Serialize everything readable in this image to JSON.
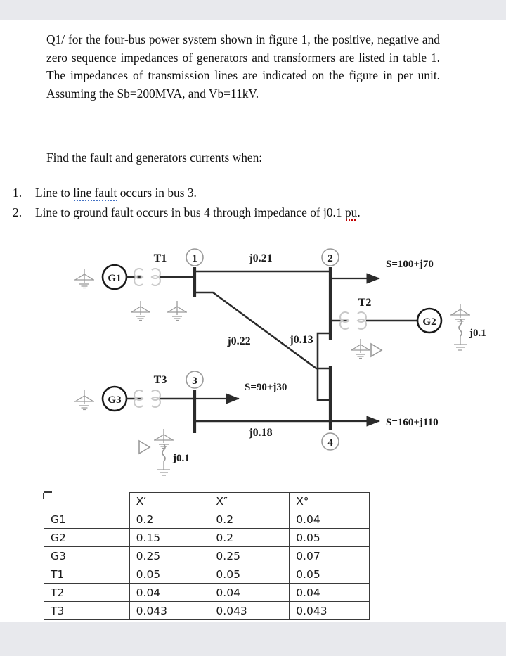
{
  "document": {
    "question_id": "Q1/",
    "paragraph_1": "Q1/ for the four-bus power system shown in figure 1, the positive, negative and zero sequence impedances of generators and transformers are listed in table 1. The impedances of transmission lines are indicated on the figure in per unit. Assuming the Sb=200MVA, and Vb=11kV.",
    "paragraph_2": "Find the fault and generators currents when:",
    "list": [
      {
        "number": "1.",
        "text_before": "Line to ",
        "misspelled": "line  fault",
        "text_after": " occurs in bus 3."
      },
      {
        "number": "2.",
        "text_before": "Line to ground fault occurs in bus 4 through impedance of j0.1 ",
        "misspelled": "pu",
        "text_after": "."
      }
    ],
    "base_values": {
      "Sb": "200MVA",
      "Vb": "11kV"
    }
  },
  "diagram": {
    "title": "figure 1",
    "buses": [
      {
        "id": "1",
        "label": "1"
      },
      {
        "id": "2",
        "label": "2"
      },
      {
        "id": "3",
        "label": "3"
      },
      {
        "id": "4",
        "label": "4"
      }
    ],
    "generators": [
      {
        "id": "G1",
        "label": "G1"
      },
      {
        "id": "G2",
        "label": "G2"
      },
      {
        "id": "G3",
        "label": "G3"
      }
    ],
    "transformers": [
      {
        "id": "T1",
        "label": "T1"
      },
      {
        "id": "T2",
        "label": "T2"
      },
      {
        "id": "T3",
        "label": "T3"
      }
    ],
    "lines": [
      {
        "from": "1",
        "to": "2",
        "label": "j0.21"
      },
      {
        "from": "1",
        "to": "4",
        "label": "j0.22"
      },
      {
        "from": "2",
        "to": "4",
        "label": "j0.13"
      },
      {
        "from": "3",
        "to": "4",
        "label": "j0.18"
      }
    ],
    "loads": [
      {
        "bus": "2",
        "label": "S=100+j70"
      },
      {
        "bus": "3",
        "label": "S=90+j30"
      },
      {
        "bus": "4",
        "label": "S=160+j110"
      }
    ],
    "grounding_impedances": [
      {
        "near": "G2",
        "label": "j0.1"
      },
      {
        "near": "T3",
        "label": "j0.1"
      }
    ]
  },
  "table": {
    "caption": "table 1",
    "headers": [
      "",
      "X′",
      "X″",
      "X°"
    ],
    "header_plain": [
      "",
      "X'",
      "X\"",
      "X0"
    ],
    "rows": [
      {
        "name": "G1",
        "x_prime": "0.2",
        "x_dprime": "0.2",
        "x_zero": "0.04"
      },
      {
        "name": "G2",
        "x_prime": "0.15",
        "x_dprime": "0.2",
        "x_zero": "0.05"
      },
      {
        "name": "G3",
        "x_prime": "0.25",
        "x_dprime": "0.25",
        "x_zero": "0.07"
      },
      {
        "name": "T1",
        "x_prime": "0.05",
        "x_dprime": "0.05",
        "x_zero": "0.05"
      },
      {
        "name": "T2",
        "x_prime": "0.04",
        "x_dprime": "0.04",
        "x_zero": "0.04"
      },
      {
        "name": "T3",
        "x_prime": "0.043",
        "x_dprime": "0.043",
        "x_zero": "0.043"
      }
    ]
  },
  "colors": {
    "page_background": "#ffffff",
    "app_background": "#e8e9ed",
    "text": "#101010",
    "line": "#2b2b2b",
    "ground_symbol": "#9a9a9a",
    "spell_blue": "#4472c4",
    "spell_red": "#c00000"
  }
}
